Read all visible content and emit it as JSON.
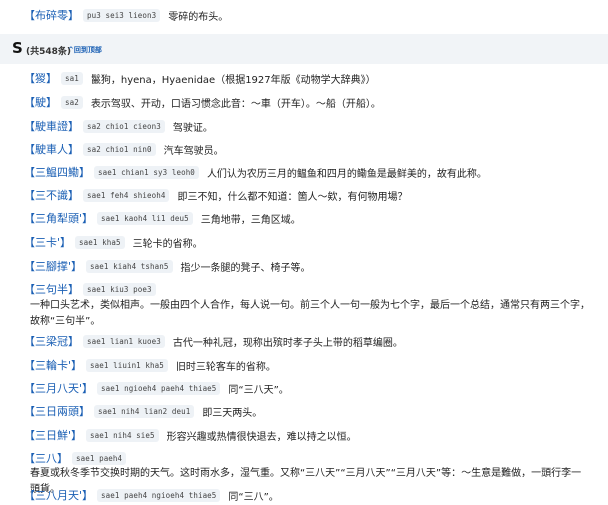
{
  "entries": [
    {
      "word": "布碎零",
      "pron": "pu3 sei3 lieon3",
      "def": "零碎的布头。"
    },
    {
      "word": "猣",
      "pron": "sa1",
      "def": "鬣狗，hyena，Hyaenidae（根据1927年版《动物学大辞典》）"
    },
    {
      "word": "駛",
      "pron": "sa2",
      "def": "表示驾驭、开动，口语习惯念此音：～車（开车）。～船（开船）。"
    },
    {
      "word": "駛車證",
      "pron": "sa2 chio1 cieon3",
      "def": "驾驶证。"
    },
    {
      "word": "駛車人",
      "pron": "sa2 chio1 nin0",
      "def": "汽车驾驶员。"
    },
    {
      "word": "三鰛四鰳",
      "pron": "sae1 chian1 sy3 leoh0",
      "def": "人们认为农历三月的鳁鱼和四月的鳓鱼是最鲜美的，故有此称。"
    },
    {
      "word": "三不識",
      "pron": "sae1 feh4 shieoh4",
      "def": "即三不知，什么都不知道：箇人～欸，有何物用場？"
    },
    {
      "word": "三角犁頭'",
      "pron": "sae1 kaoh4 li1 deu5",
      "def": "三角地带，三角区域。"
    },
    {
      "word": "三卡'",
      "pron": "sae1 kha5",
      "def": "三轮卡的省称。"
    },
    {
      "word": "三腳撑'",
      "pron": "sae1 kiah4 tshan5",
      "def": "指少一条腿的凳子、椅子等。"
    },
    {
      "word": "三句半",
      "pron": "sae1 kiu3 poe3",
      "def": "一种口头艺术，类似相声。一般由四个人合作，每人说一句。前三个人一句一般为七个字，最后一个总结，通常只有两三个字，故称“三句半”。"
    },
    {
      "word": "三梁冠",
      "pron": "sae1 lian1 kuoe3",
      "def": "古代一种礼冠，现称出殡时孝子头上带的稻草编圈。"
    },
    {
      "word": "三輪卡'",
      "pron": "sae1 liuin1 kha5",
      "def": "旧时三轮客车的省称。"
    },
    {
      "word": "三月八天'",
      "pron": "sae1 ngioeh4 paeh4 thiae5",
      "def": "同“三八天”。"
    },
    {
      "word": "三日兩頭",
      "pron": "sae1 nih4 lian2 deu1",
      "def": "即三天两头。"
    },
    {
      "word": "三日鮮'",
      "pron": "sae1 nih4 sie5",
      "def": "形容兴趣或热情很快退去，难以持之以恒。"
    },
    {
      "word": "三八",
      "pron": "sae1 paeh4",
      "def": "春夏或秋冬季节交换时期的天气。这时雨水多，湿气重。又称“三八天”“三月八天”“三月八天”等：～生意是難做，一頭行李一頭貨。"
    },
    {
      "word": "三八月天'",
      "pron": "sae1 paeh4 ngioeh4 thiae5",
      "def": "同“三八”。"
    }
  ],
  "section": {
    "letter": "S",
    "count": "(共548条)",
    "top_link": "^回到顶部"
  },
  "colors": {
    "link": "#1a5fb4",
    "header_bg": "#f1f4f7",
    "pron_bg": "#eef2f6"
  }
}
